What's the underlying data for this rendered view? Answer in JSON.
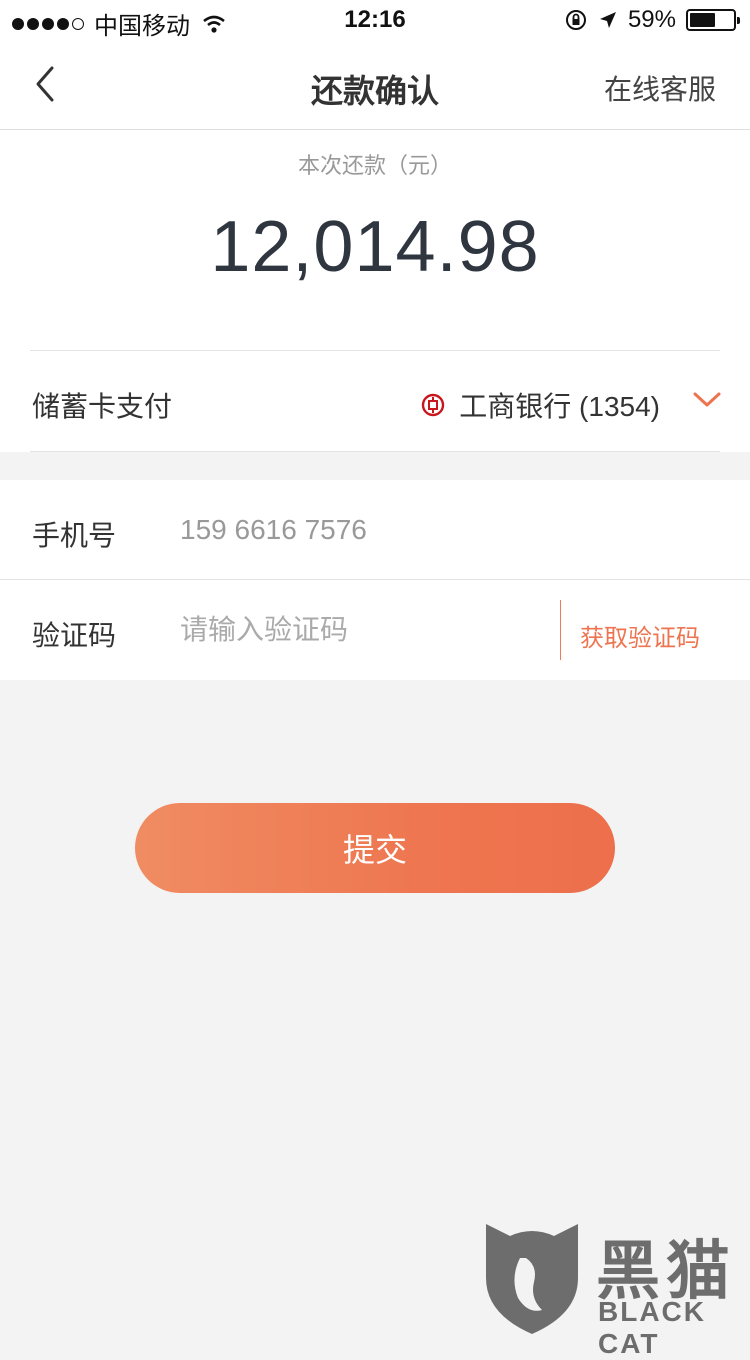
{
  "status_bar": {
    "carrier": "中国移动",
    "time": "12:16",
    "battery_percent": "59%",
    "battery_level": 0.59
  },
  "nav": {
    "title": "还款确认",
    "right_action": "在线客服"
  },
  "amount": {
    "label": "本次还款（元）",
    "value": "12,014.98"
  },
  "payment": {
    "label": "储蓄卡支付",
    "bank": "工商银行 (1354)",
    "bank_icon": "icbc-logo-icon",
    "accent_color": "#ee7450"
  },
  "form": {
    "phone_label": "手机号",
    "phone_value": "159 6616 7576",
    "code_label": "验证码",
    "code_placeholder": "请输入验证码",
    "get_code_label": "获取验证码"
  },
  "submit_label": "提交",
  "watermark": {
    "cn": "黑猫",
    "en": "BLACK CAT"
  }
}
